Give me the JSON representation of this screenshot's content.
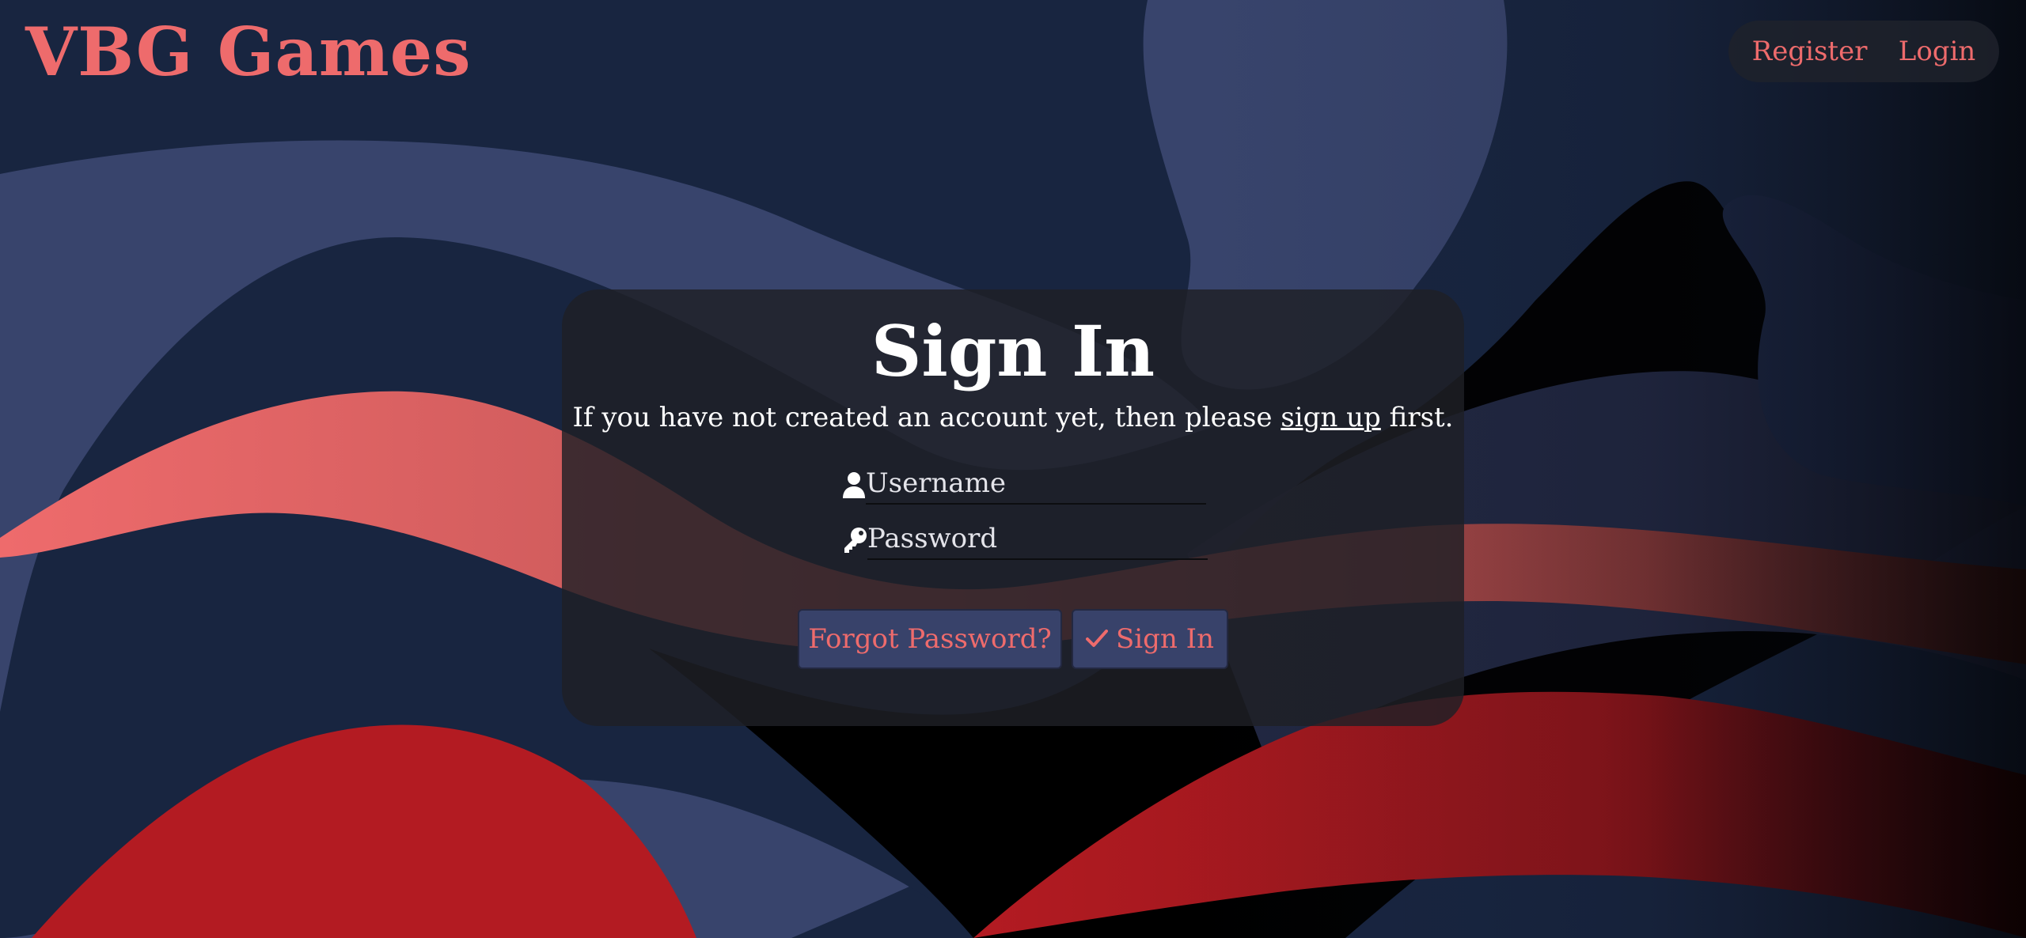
{
  "brand": {
    "title": "VBG Games"
  },
  "nav": {
    "register_label": "Register",
    "login_label": "Login"
  },
  "card": {
    "title": "Sign In",
    "subtitle_before": "If you have not created an account yet, then please ",
    "subtitle_link": "sign up",
    "subtitle_after": " first.",
    "username_placeholder": "Username",
    "password_placeholder": "Password",
    "forgot_label": "Forgot Password?",
    "signin_label": "Sign In"
  },
  "icons": {
    "username": "user-icon",
    "password": "key-icon",
    "signin": "check-icon"
  },
  "colors": {
    "background": "#182540",
    "accent": "#ee6b6c",
    "button_bg": "#38426a",
    "card_bg": "rgba(30,32,38,0.82)",
    "wave_slate": "#38446c",
    "wave_coral": "#ee6b6c",
    "wave_red": "#b31b22"
  }
}
